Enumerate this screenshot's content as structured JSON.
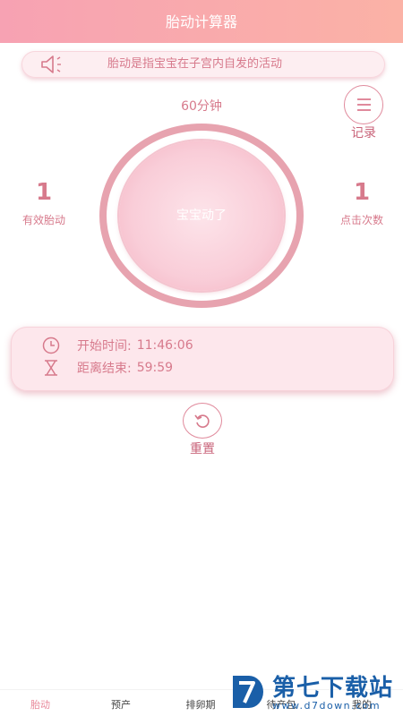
{
  "header": {
    "title": "胎动计算器"
  },
  "notice": {
    "text": "胎动是指宝宝在子宫内自发的活动",
    "icon": "speaker-icon"
  },
  "session": {
    "duration_label": "60分钟"
  },
  "record": {
    "label": "记录",
    "icon": "menu-icon"
  },
  "stats": {
    "effective": {
      "value": "1",
      "label": "有效胎动"
    },
    "clicks": {
      "value": "1",
      "label": "点击次数"
    }
  },
  "main_button": {
    "label": "宝宝动了"
  },
  "timer": {
    "start_label": "开始时间:",
    "start_value": "11:46:06",
    "remaining_label": "距离结束:",
    "remaining_value": "59:59",
    "start_icon": "clock-icon",
    "remaining_icon": "hourglass-icon"
  },
  "reset": {
    "label": "重置",
    "icon": "refresh-icon"
  },
  "tabs": [
    {
      "label": "胎动",
      "active": true
    },
    {
      "label": "预产",
      "active": false
    },
    {
      "label": "排卵期",
      "active": false
    },
    {
      "label": "待产包",
      "active": false
    },
    {
      "label": "我的",
      "active": false
    }
  ],
  "watermark": {
    "title": "第七下载站",
    "url": "www.d7down.com"
  },
  "colors": {
    "accent": "#e08a9c",
    "header_start": "#f7a2b3",
    "header_end": "#fbb2a6",
    "watermark": "#1a5fa8"
  }
}
